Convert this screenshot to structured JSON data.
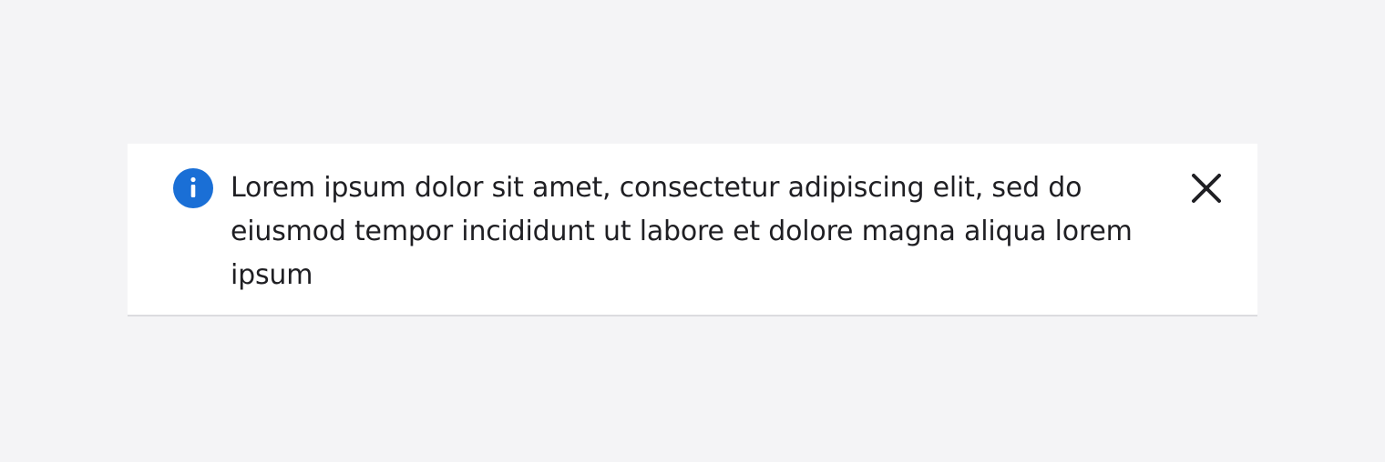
{
  "notification": {
    "type": "info",
    "icon": "info-icon",
    "message": "Lorem ipsum dolor sit amet, consectetur adipiscing elit, sed do eiusmod tempor incididunt ut labore et dolore magna aliqua lorem ipsum",
    "close_icon": "close-icon"
  },
  "colors": {
    "page_background": "#f4f4f6",
    "banner_background": "#ffffff",
    "info_accent": "#1a6fd6",
    "text": "#1f1f23",
    "divider": "#dcdcdf"
  }
}
